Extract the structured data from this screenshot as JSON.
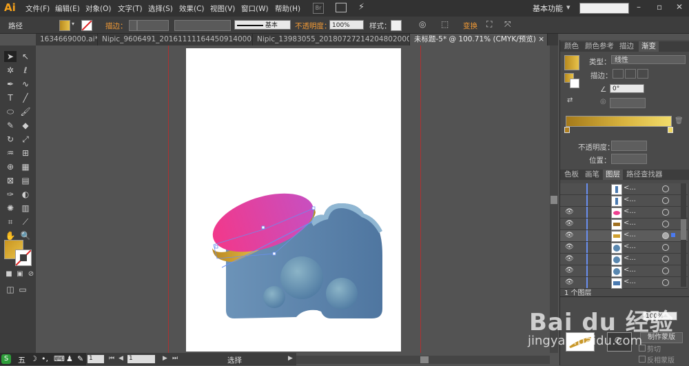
{
  "app": {
    "logo": "Ai"
  },
  "menu": [
    "文件(F)",
    "编辑(E)",
    "对象(O)",
    "文字(T)",
    "选择(S)",
    "效果(C)",
    "视图(V)",
    "窗口(W)",
    "帮助(H)"
  ],
  "menu_extra": {
    "br": "Br"
  },
  "workspace": {
    "label": "基本功能",
    "arrow": "▾"
  },
  "window_controls": {
    "minimize": "–",
    "restore": "▫",
    "close": "✕"
  },
  "control_bar": {
    "object_type": "路径",
    "stroke_label": "描边：",
    "stroke_line_label": "基本",
    "opacity_label": "不透明度：",
    "opacity_value": "100%",
    "style_label": "样式：",
    "transform_label": "变换"
  },
  "tabs": [
    {
      "label": "1634669000.ai* ×"
    },
    {
      "label": "Nipic_9606491_20161111164450914000.ai* ×"
    },
    {
      "label": "Nipic_13983055_20180727214204802000.ai* ×"
    },
    {
      "label": "未标题-5* @ 100.71% (CMYK/预览) ×"
    }
  ],
  "status": {
    "zoom": "1",
    "page": "1",
    "tool": "选择"
  },
  "gradient_panel": {
    "tabs": [
      "颜色",
      "颜色参考",
      "描边",
      "渐变"
    ],
    "type_label": "类型：",
    "type_value": "线性",
    "stroke_label": "描边：",
    "angle_value": "0°",
    "opacity_label": "不透明度：",
    "position_label": "位置："
  },
  "layers_panel": {
    "tabs": [
      "色板",
      "画笔",
      "图层",
      "路径查找器"
    ],
    "rows": [
      {
        "name": "<..."
      },
      {
        "name": "<..."
      },
      {
        "name": "<..."
      },
      {
        "name": "<..."
      },
      {
        "name": "<..."
      },
      {
        "name": "<..."
      },
      {
        "name": "<..."
      },
      {
        "name": "<..."
      },
      {
        "name": "<..."
      }
    ],
    "footer_label": "1 个图层"
  },
  "transparency_panel": {
    "opacity_value": "100%",
    "make_mask_label": "制作蒙版",
    "clip_label": "剪切",
    "invert_label": "反相蒙版"
  },
  "watermark": {
    "line1": "Bai du 经验",
    "line2": "jingyan.baidu.com"
  },
  "colors": {
    "gold": "#d6a62c",
    "pink": "#f2388a",
    "magenta": "#c84fc0",
    "body_blue": "#5b80a8",
    "accent_orange": "#f29a35"
  }
}
